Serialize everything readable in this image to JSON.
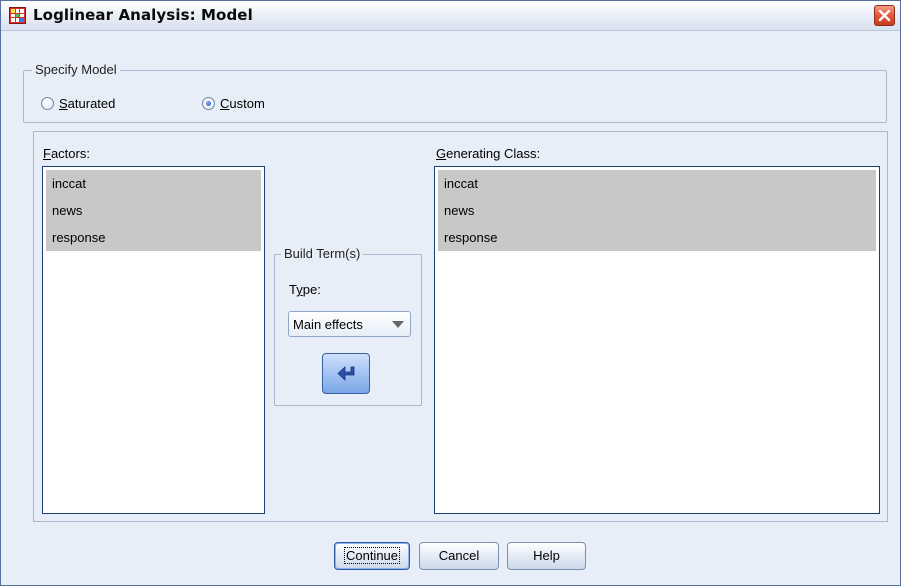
{
  "window": {
    "title": "Loglinear Analysis: Model",
    "icons": {
      "app": "spss-grid-icon",
      "close": "close-icon"
    }
  },
  "specify_model": {
    "legend": "Specify Model",
    "options": [
      {
        "label": "Saturated",
        "checked": false
      },
      {
        "label": "Custom",
        "checked": true
      }
    ]
  },
  "factors": {
    "label": "Factors:",
    "items": [
      "inccat",
      "news",
      "response"
    ]
  },
  "build_terms": {
    "legend": "Build Term(s)",
    "type_label": "Type:",
    "type_value": "Main effects",
    "move_icon": "arrow-right-icon"
  },
  "generating_class": {
    "label": "Generating Class:",
    "items": [
      "inccat",
      "news",
      "response"
    ]
  },
  "buttons": {
    "continue": "Continue",
    "cancel": "Cancel",
    "help": "Help"
  },
  "colors": {
    "selection": "#c8c8c8",
    "dialog_bg": "#e8eef7",
    "close_button": "#e55a3c"
  }
}
